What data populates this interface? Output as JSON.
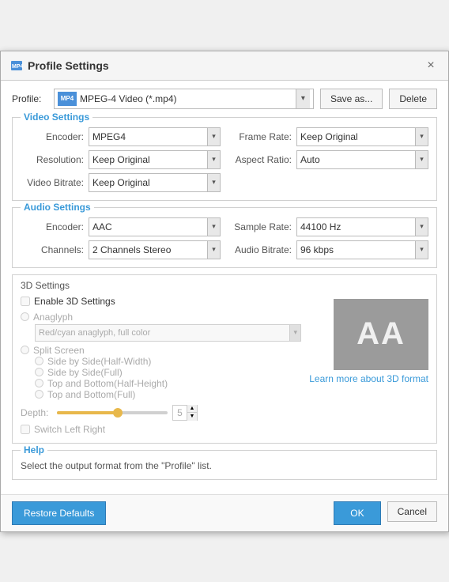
{
  "dialog": {
    "title": "Profile Settings",
    "close_label": "×"
  },
  "profile": {
    "label": "Profile:",
    "selected": "MPEG-4 Video (*.mp4)",
    "save_as_label": "Save as...",
    "delete_label": "Delete"
  },
  "video_settings": {
    "title": "Video Settings",
    "encoder_label": "Encoder:",
    "encoder_value": "MPEG4",
    "resolution_label": "Resolution:",
    "resolution_value": "Keep Original",
    "video_bitrate_label": "Video Bitrate:",
    "video_bitrate_value": "Keep Original",
    "frame_rate_label": "Frame Rate:",
    "frame_rate_value": "Keep Original",
    "aspect_ratio_label": "Aspect Ratio:",
    "aspect_ratio_value": "Auto"
  },
  "audio_settings": {
    "title": "Audio Settings",
    "encoder_label": "Encoder:",
    "encoder_value": "AAC",
    "channels_label": "Channels:",
    "channels_value": "2 Channels Stereo",
    "sample_rate_label": "Sample Rate:",
    "sample_rate_value": "44100 Hz",
    "audio_bitrate_label": "Audio Bitrate:",
    "audio_bitrate_value": "96 kbps"
  },
  "settings_3d": {
    "title": "3D Settings",
    "enable_label": "Enable 3D Settings",
    "anaglyph_label": "Anaglyph",
    "anaglyph_option": "Red/cyan anaglyph, full color",
    "split_screen_label": "Split Screen",
    "side_by_side_half_label": "Side by Side(Half-Width)",
    "side_by_side_full_label": "Side by Side(Full)",
    "top_bottom_half_label": "Top and Bottom(Half-Height)",
    "top_bottom_full_label": "Top and Bottom(Full)",
    "depth_label": "Depth:",
    "depth_value": "5",
    "switch_lr_label": "Switch Left Right",
    "learn_more_label": "Learn more about 3D format",
    "preview_text": "AA"
  },
  "help": {
    "title": "Help",
    "text": "Select the output format from the \"Profile\" list."
  },
  "footer": {
    "restore_defaults_label": "Restore Defaults",
    "ok_label": "OK",
    "cancel_label": "Cancel"
  }
}
